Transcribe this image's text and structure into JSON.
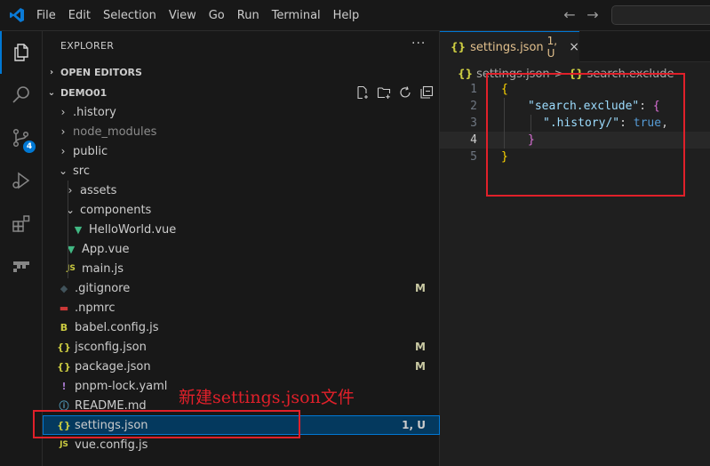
{
  "menu": [
    "File",
    "Edit",
    "Selection",
    "View",
    "Go",
    "Run",
    "Terminal",
    "Help"
  ],
  "activity_badge": "4",
  "explorer": {
    "title": "EXPLORER",
    "more": "···",
    "open_editors": "OPEN EDITORS",
    "project": "DEMO01"
  },
  "tree": [
    {
      "label": ".history",
      "type": "folder",
      "expanded": false,
      "status": ""
    },
    {
      "label": "node_modules",
      "type": "folder",
      "expanded": false,
      "status": "",
      "dim": true
    },
    {
      "label": "public",
      "type": "folder",
      "expanded": false,
      "status": ""
    },
    {
      "label": "src",
      "type": "folder",
      "expanded": true,
      "status": ""
    },
    {
      "label": "assets",
      "type": "folder",
      "expanded": false,
      "status": ""
    },
    {
      "label": "components",
      "type": "folder",
      "expanded": true,
      "status": ""
    },
    {
      "label": "HelloWorld.vue",
      "type": "vue",
      "status": ""
    },
    {
      "label": "App.vue",
      "type": "vue",
      "status": ""
    },
    {
      "label": "main.js",
      "type": "js",
      "status": ""
    },
    {
      "label": ".gitignore",
      "type": "git",
      "status": "M"
    },
    {
      "label": ".npmrc",
      "type": "npm",
      "status": ""
    },
    {
      "label": "babel.config.js",
      "type": "babel",
      "status": ""
    },
    {
      "label": "jsconfig.json",
      "type": "json",
      "status": "M"
    },
    {
      "label": "package.json",
      "type": "json",
      "status": "M"
    },
    {
      "label": "pnpm-lock.yaml",
      "type": "yaml",
      "status": ""
    },
    {
      "label": "README.md",
      "type": "info",
      "status": ""
    },
    {
      "label": "settings.json",
      "type": "json",
      "status": "1, U",
      "selected": true
    },
    {
      "label": "vue.config.js",
      "type": "js",
      "status": ""
    }
  ],
  "tab": {
    "title": "settings.json",
    "status": "1, U",
    "close": "×"
  },
  "breadcrumb": {
    "file": "settings.json",
    "sep": ">",
    "symbol": "search.exclude"
  },
  "code": {
    "line_numbers": [
      "1",
      "2",
      "3",
      "4",
      "5"
    ],
    "open_brace": "{",
    "key1": "\"search.exclude\"",
    "colon": ": ",
    "inner_open": "{",
    "key2": "\".history/\"",
    "value": "true",
    "comma": ",",
    "inner_close": "}",
    "close_brace": "}"
  },
  "annotation": "新建settings.json文件",
  "colors": {
    "accent": "#0078d4",
    "annotation": "#e0202a",
    "modified": "#e2c08d"
  }
}
